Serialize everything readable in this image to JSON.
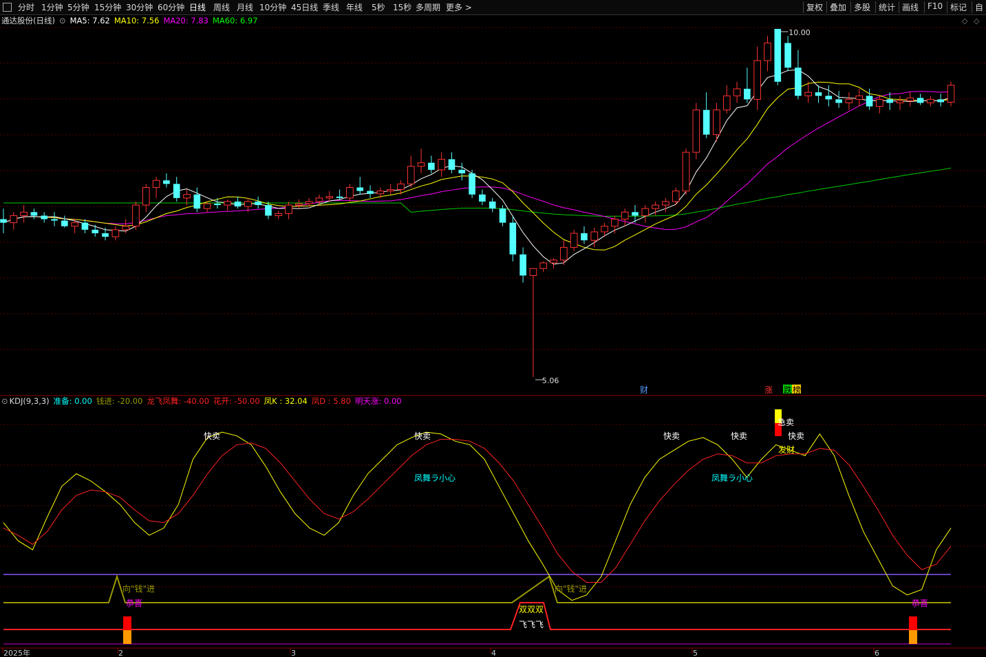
{
  "toolbar": {
    "periods": [
      "分时",
      "1分钟",
      "5分钟",
      "15分钟",
      "30分钟",
      "60分钟",
      "日线",
      "周线",
      "月线",
      "10分钟",
      "45日线",
      "季线",
      "年线",
      "5秒",
      "15秒",
      "多周期",
      "更多 >"
    ],
    "active_period": "日线",
    "right_buttons": [
      "复权",
      "叠加",
      "多股",
      "统计",
      "画线",
      "F10",
      "标记",
      "自"
    ]
  },
  "main_panel": {
    "title": "通达股份(日线)",
    "ma": [
      {
        "label": "MA5: 7.62",
        "color": "#ffffff"
      },
      {
        "label": "MA10: 7.56",
        "color": "#ffff00"
      },
      {
        "label": "MA20: 7.83",
        "color": "#ff00ff"
      },
      {
        "label": "MA60: 6.97",
        "color": "#00ff00"
      }
    ],
    "high_label": "10.00",
    "low_label": "5.06",
    "event_marks": [
      {
        "text": "财",
        "color": "#5599ff",
        "bg": "#000000"
      },
      {
        "text": "涨",
        "color": "#ff3333",
        "bg": "#000000"
      },
      {
        "text": "跌",
        "color": "#000000",
        "bg": "#00cc00"
      },
      {
        "text": "榜",
        "color": "#000000",
        "bg": "#ffcc00"
      }
    ]
  },
  "kdj_panel": {
    "title": "KDJ(9,3,3)",
    "params": [
      {
        "label": "准备: 0.00",
        "color": "#00ffff"
      },
      {
        "label": "钱进: -20.00",
        "color": "#999900"
      },
      {
        "label": "龙飞凤舞: -40.00",
        "color": "#ff2222"
      },
      {
        "label": "花开: -50.00",
        "color": "#ff2222"
      },
      {
        "label": "凤K : 32.04",
        "color": "#ffff00"
      },
      {
        "label": "凤D : 5.80",
        "color": "#ff2222"
      },
      {
        "label": "明天涨: 0.00",
        "color": "#ff00ff"
      }
    ],
    "annotations": [
      {
        "text": "快卖",
        "color": "#ffffff"
      },
      {
        "text": "快卖",
        "color": "#ffffff"
      },
      {
        "text": "快卖",
        "color": "#ffffff"
      },
      {
        "text": "快卖",
        "color": "#ffffff"
      },
      {
        "text": "快卖",
        "color": "#ffffff"
      },
      {
        "text": "急卖",
        "color": "#ffffff"
      },
      {
        "text": "发财",
        "color": "#ffff00"
      },
      {
        "text": "凤舞ラ小心",
        "color": "#00ffff"
      },
      {
        "text": "凤舞ラ小心",
        "color": "#00ffff"
      },
      {
        "text": "向\"钱\"进",
        "color": "#999900"
      },
      {
        "text": "向\"钱\"进",
        "color": "#999900"
      },
      {
        "text": "恭喜",
        "color": "#ff00ff"
      },
      {
        "text": "恭喜",
        "color": "#ff00ff"
      },
      {
        "text": "双双双",
        "color": "#ffff00"
      },
      {
        "text": "飞飞飞",
        "color": "#ffffff"
      }
    ]
  },
  "time_axis": [
    "2025年",
    "2",
    "3",
    "4",
    "5",
    "6"
  ],
  "colors": {
    "up": "#ff3333",
    "down": "#54ffff",
    "ma5": "#ffffff",
    "ma10": "#ffff00",
    "ma20": "#ff00ff",
    "ma60": "#00cc00",
    "grid": "#5a0000",
    "k": "#ffff00",
    "d": "#ff2222"
  },
  "chart_data": [
    {
      "type": "candlestick",
      "title": "通达股份(日线)",
      "y_range": [
        5.06,
        10.0
      ],
      "series_labels": [
        "MA5",
        "MA10",
        "MA20",
        "MA60"
      ],
      "candles": [
        [
          7.3,
          7.45,
          7.1,
          7.25
        ],
        [
          7.25,
          7.4,
          7.15,
          7.35
        ],
        [
          7.35,
          7.5,
          7.25,
          7.4
        ],
        [
          7.4,
          7.45,
          7.3,
          7.35
        ],
        [
          7.35,
          7.4,
          7.25,
          7.3
        ],
        [
          7.3,
          7.4,
          7.2,
          7.28
        ],
        [
          7.28,
          7.35,
          7.18,
          7.2
        ],
        [
          7.2,
          7.3,
          7.1,
          7.25
        ],
        [
          7.25,
          7.3,
          7.1,
          7.15
        ],
        [
          7.15,
          7.22,
          7.05,
          7.1
        ],
        [
          7.1,
          7.18,
          7.0,
          7.05
        ],
        [
          7.05,
          7.2,
          7.0,
          7.15
        ],
        [
          7.15,
          7.3,
          7.1,
          7.2
        ],
        [
          7.2,
          7.55,
          7.15,
          7.5
        ],
        [
          7.5,
          7.8,
          7.4,
          7.75
        ],
        [
          7.75,
          7.9,
          7.6,
          7.85
        ],
        [
          7.85,
          7.95,
          7.75,
          7.8
        ],
        [
          7.8,
          7.9,
          7.55,
          7.6
        ],
        [
          7.6,
          7.72,
          7.5,
          7.65
        ],
        [
          7.65,
          7.75,
          7.4,
          7.45
        ],
        [
          7.45,
          7.55,
          7.4,
          7.52
        ],
        [
          7.52,
          7.6,
          7.45,
          7.5
        ],
        [
          7.5,
          7.58,
          7.42,
          7.55
        ],
        [
          7.55,
          7.62,
          7.45,
          7.48
        ],
        [
          7.48,
          7.6,
          7.4,
          7.55
        ],
        [
          7.55,
          7.62,
          7.45,
          7.5
        ],
        [
          7.5,
          7.55,
          7.3,
          7.35
        ],
        [
          7.35,
          7.42,
          7.3,
          7.38
        ],
        [
          7.38,
          7.55,
          7.3,
          7.5
        ],
        [
          7.5,
          7.58,
          7.45,
          7.52
        ],
        [
          7.52,
          7.6,
          7.48,
          7.55
        ],
        [
          7.55,
          7.65,
          7.5,
          7.6
        ],
        [
          7.6,
          7.7,
          7.55,
          7.62
        ],
        [
          7.62,
          7.72,
          7.58,
          7.6
        ],
        [
          7.6,
          7.8,
          7.55,
          7.75
        ],
        [
          7.75,
          7.9,
          7.65,
          7.7
        ],
        [
          7.7,
          7.78,
          7.6,
          7.66
        ],
        [
          7.66,
          7.75,
          7.6,
          7.7
        ],
        [
          7.7,
          7.8,
          7.65,
          7.72
        ],
        [
          7.72,
          7.85,
          7.65,
          7.8
        ],
        [
          7.8,
          8.2,
          7.75,
          8.05
        ],
        [
          8.05,
          8.3,
          7.95,
          8.1
        ],
        [
          8.1,
          8.2,
          7.95,
          8.0
        ],
        [
          8.0,
          8.25,
          7.9,
          8.15
        ],
        [
          8.15,
          8.25,
          7.95,
          8.0
        ],
        [
          8.0,
          8.1,
          7.85,
          7.95
        ],
        [
          7.95,
          8.0,
          7.6,
          7.65
        ],
        [
          7.65,
          7.72,
          7.5,
          7.55
        ],
        [
          7.55,
          7.6,
          7.4,
          7.45
        ],
        [
          7.45,
          7.5,
          7.2,
          7.25
        ],
        [
          7.25,
          7.35,
          6.7,
          6.8
        ],
        [
          6.8,
          6.9,
          6.4,
          6.5
        ],
        [
          6.5,
          6.6,
          5.06,
          6.6
        ],
        [
          6.6,
          6.7,
          6.55,
          6.68
        ],
        [
          6.68,
          6.75,
          6.6,
          6.72
        ],
        [
          6.72,
          7.0,
          6.65,
          6.9
        ],
        [
          6.9,
          7.15,
          6.85,
          7.1
        ],
        [
          7.1,
          7.2,
          6.95,
          7.0
        ],
        [
          7.0,
          7.18,
          6.9,
          7.12
        ],
        [
          7.12,
          7.25,
          7.05,
          7.2
        ],
        [
          7.2,
          7.35,
          7.1,
          7.3
        ],
        [
          7.3,
          7.45,
          7.2,
          7.4
        ],
        [
          7.4,
          7.5,
          7.25,
          7.35
        ],
        [
          7.35,
          7.5,
          7.25,
          7.45
        ],
        [
          7.45,
          7.55,
          7.35,
          7.5
        ],
        [
          7.5,
          7.6,
          7.4,
          7.55
        ],
        [
          7.55,
          7.75,
          7.5,
          7.7
        ],
        [
          7.7,
          8.3,
          7.65,
          8.25
        ],
        [
          8.25,
          8.95,
          8.15,
          8.85
        ],
        [
          8.85,
          9.1,
          8.45,
          8.5
        ],
        [
          8.5,
          8.95,
          8.4,
          8.85
        ],
        [
          8.85,
          9.2,
          8.8,
          9.05
        ],
        [
          9.05,
          9.25,
          8.95,
          9.15
        ],
        [
          9.15,
          9.45,
          8.95,
          9.0
        ],
        [
          9.0,
          9.75,
          8.85,
          9.55
        ],
        [
          9.55,
          9.9,
          9.4,
          9.8
        ],
        [
          10.0,
          10.0,
          9.2,
          9.25
        ],
        [
          9.8,
          9.9,
          9.4,
          9.45
        ],
        [
          9.45,
          9.7,
          9.0,
          9.05
        ],
        [
          9.05,
          9.25,
          8.95,
          9.1
        ],
        [
          9.1,
          9.2,
          8.95,
          9.05
        ],
        [
          9.05,
          9.2,
          8.9,
          9.0
        ],
        [
          9.0,
          9.12,
          8.88,
          8.95
        ],
        [
          8.95,
          9.1,
          8.85,
          9.0
        ],
        [
          9.0,
          9.15,
          8.9,
          9.05
        ],
        [
          9.05,
          9.15,
          8.85,
          8.9
        ],
        [
          8.9,
          9.05,
          8.8,
          9.0
        ],
        [
          9.0,
          9.1,
          8.85,
          8.95
        ],
        [
          8.95,
          9.05,
          8.85,
          8.98
        ],
        [
          8.98,
          9.1,
          8.9,
          9.02
        ],
        [
          9.02,
          9.08,
          8.92,
          8.95
        ],
        [
          8.95,
          9.05,
          8.9,
          9.0
        ],
        [
          9.0,
          9.08,
          8.9,
          8.96
        ],
        [
          8.96,
          9.25,
          8.9,
          9.2
        ]
      ],
      "ma5_last": 7.62,
      "ma10_last": 7.56,
      "ma20_last": 7.83,
      "ma60_last": 6.97
    },
    {
      "type": "line",
      "title": "KDJ(9,3,3)",
      "k": [
        45,
        35,
        30,
        48,
        65,
        72,
        68,
        62,
        55,
        45,
        38,
        42,
        55,
        80,
        92,
        95,
        93,
        88,
        76,
        62,
        50,
        42,
        38,
        45,
        60,
        72,
        80,
        88,
        92,
        95,
        94,
        90,
        88,
        80,
        65,
        50,
        35,
        22,
        8,
        2,
        5,
        15,
        35,
        55,
        70,
        80,
        85,
        90,
        92,
        88,
        80,
        70,
        80,
        88,
        85,
        82,
        94,
        82,
        60,
        40,
        25,
        10,
        5,
        8,
        30,
        42
      ],
      "d": [
        42,
        38,
        33,
        40,
        52,
        60,
        63,
        62,
        59,
        52,
        46,
        45,
        50,
        60,
        72,
        82,
        88,
        89,
        86,
        78,
        68,
        58,
        50,
        47,
        51,
        58,
        66,
        74,
        82,
        88,
        91,
        91,
        90,
        86,
        78,
        68,
        55,
        42,
        28,
        18,
        12,
        12,
        20,
        33,
        46,
        57,
        66,
        74,
        80,
        83,
        82,
        78,
        78,
        82,
        83,
        83,
        86,
        85,
        77,
        65,
        52,
        38,
        27,
        19,
        22,
        32
      ]
    }
  ]
}
